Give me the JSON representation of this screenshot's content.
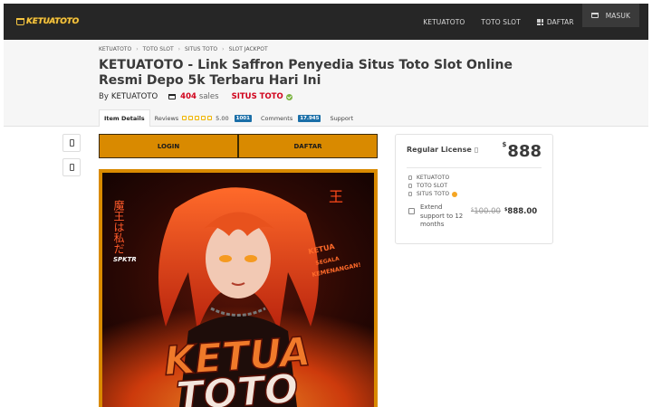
{
  "brand": {
    "logo_text": "KETUATOTO"
  },
  "nav": {
    "items": [
      "KETUATOTO",
      "TOTO SLOT",
      "DAFTAR",
      "MASUK"
    ]
  },
  "breadcrumbs": [
    "KETUATOTO",
    "TOTO SLOT",
    "SITUS TOTO",
    "SLOT JACKPOT"
  ],
  "page": {
    "title": "KETUATOTO - Link Saffron Penyedia Situs Toto Slot Online Resmi Depo 5k Terbaru Hari Ini",
    "by_label": "By",
    "author": "KETUATOTO",
    "sales_count": "404",
    "sales_label": "sales",
    "situs_label": "SITUS TOTO"
  },
  "tabs": {
    "item_details": "Item Details",
    "reviews": "Reviews",
    "rating": "5.00",
    "reviews_count": "1001",
    "comments": "Comments",
    "comments_count": "17.945",
    "support": "Support"
  },
  "buttons": {
    "login": "LOGIN",
    "daftar": "DAFTAR"
  },
  "banner": {
    "vertical_text": "魔王は私だ",
    "stamp_text": "王",
    "tag": "SPKTR",
    "side_text_1": "KETUA",
    "side_text_2": "SEGALA",
    "side_text_3": "KEMENANGAN!",
    "big_1": "KETUA",
    "big_2": "TOTO"
  },
  "license": {
    "title": "Regular License",
    "currency": "$",
    "price": "888",
    "features": [
      "KETUATOTO",
      "TOTO SLOT",
      "SITUS TOTO"
    ],
    "extend_text": "Extend support to 12 months",
    "old_price": "100.00",
    "new_price": "888.00"
  },
  "colors": {
    "accent": "#d98a00",
    "topbar": "#262626",
    "red": "#d0021b",
    "badge": "#1b6fa8"
  }
}
